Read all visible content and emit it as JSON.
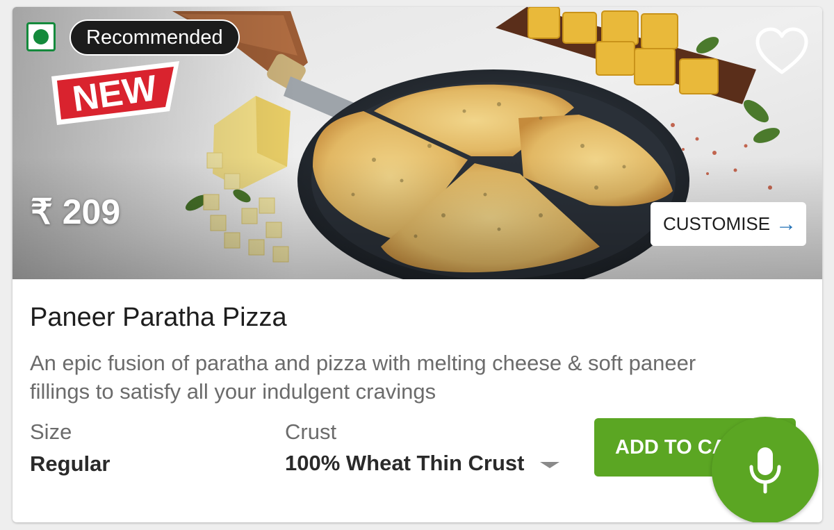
{
  "product": {
    "badge": "Recommended",
    "new_tag": "NEW",
    "price": "₹ 209",
    "customise_label": "CUSTOMISE",
    "customise_arrow": "→",
    "name": "Paneer Paratha Pizza",
    "description": "An epic fusion of paratha and pizza with melting cheese & soft paneer fillings to satisfy all your indulgent cravings",
    "size_label": "Size",
    "size_value": "Regular",
    "crust_label": "Crust",
    "crust_value": "100% Wheat Thin Crust",
    "add_to_cart_label": "ADD TO CAR"
  },
  "icons": {
    "veg": "veg-indicator-icon",
    "favorite": "heart-icon",
    "customise": "arrow-right-icon",
    "dropdown": "caret-down-icon",
    "voice": "microphone-icon"
  },
  "colors": {
    "veg_green": "#148a3c",
    "accent_green": "#5ba623",
    "new_red": "#d9232e",
    "link_blue": "#1f6fb5"
  }
}
